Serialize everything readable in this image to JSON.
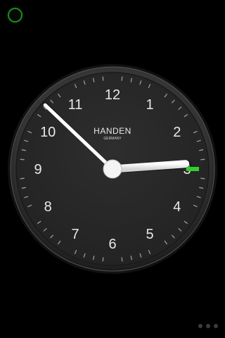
{
  "clock": {
    "brand": "HANDEN",
    "subtitle": "GERMANY",
    "numerals": [
      "12",
      "1",
      "2",
      "3",
      "4",
      "5",
      "6",
      "7",
      "8",
      "9",
      "10",
      "11"
    ],
    "time": {
      "hour": 2,
      "minute": 52,
      "second": 15
    },
    "colors": {
      "face": "#2a2a2a",
      "bezel": "#3a3a3a",
      "numerals": "#e8e8e8",
      "hands": "#ffffff",
      "second_hand": "#2ed12e",
      "status_ring": "#1e8a1e"
    }
  },
  "pager": {
    "page_count": 3,
    "current_page": 1
  }
}
